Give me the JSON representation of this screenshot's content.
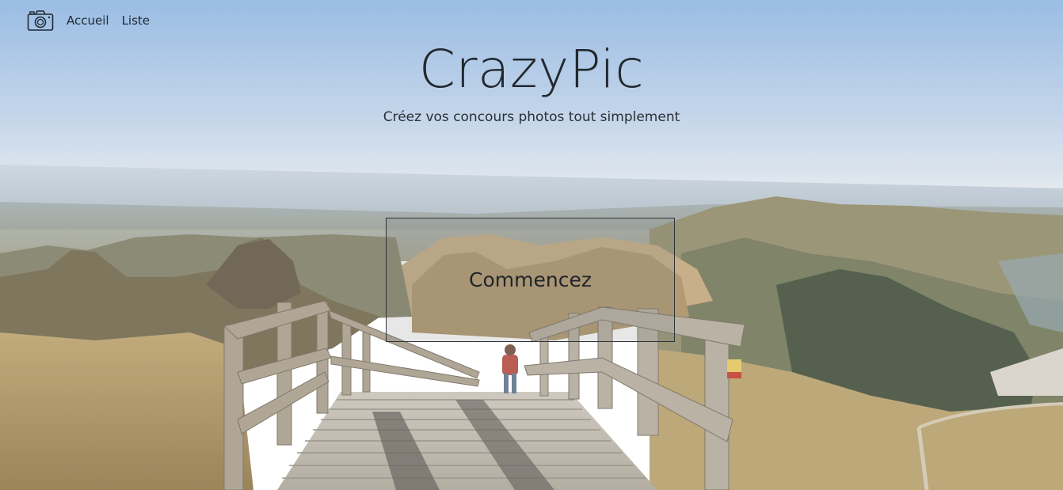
{
  "nav": {
    "brand_icon": "camera-icon",
    "links": [
      {
        "label": "Accueil"
      },
      {
        "label": "Liste"
      }
    ]
  },
  "hero": {
    "title": "CrazyPic",
    "subtitle": "Créez vos concours photos tout simplement",
    "cta_label": "Commencez"
  },
  "colors": {
    "sky_top": "#8fb6e0",
    "sky_horizon": "#dfe7ee",
    "text": "#22282e"
  }
}
